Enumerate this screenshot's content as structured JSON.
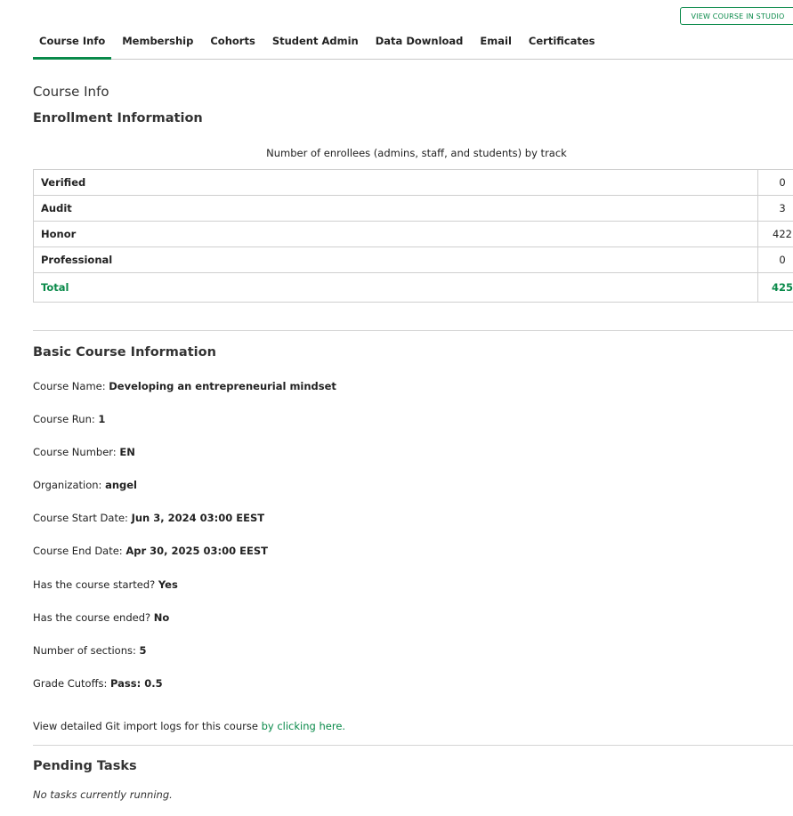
{
  "header": {
    "studio_button": "VIEW COURSE IN STUDIO"
  },
  "tabs": [
    {
      "label": "Course Info",
      "active": true
    },
    {
      "label": "Membership"
    },
    {
      "label": "Cohorts"
    },
    {
      "label": "Student Admin"
    },
    {
      "label": "Data Download"
    },
    {
      "label": "Email"
    },
    {
      "label": "Certificates"
    }
  ],
  "page_title": "Course Info",
  "enrollment": {
    "heading": "Enrollment Information",
    "caption": "Number of enrollees (admins, staff, and students) by track",
    "rows": [
      {
        "label": "Verified",
        "value": "0"
      },
      {
        "label": "Audit",
        "value": "3"
      },
      {
        "label": "Honor",
        "value": "422"
      },
      {
        "label": "Professional",
        "value": "0"
      }
    ],
    "total": {
      "label": "Total",
      "value": "425"
    }
  },
  "basic": {
    "heading": "Basic Course Information",
    "fields": [
      {
        "label": "Course Name: ",
        "value": "Developing an entrepreneurial mindset"
      },
      {
        "label": "Course Run: ",
        "value": "1"
      },
      {
        "label": "Course Number: ",
        "value": "EN"
      },
      {
        "label": "Organization: ",
        "value": "angel"
      },
      {
        "label": "Course Start Date: ",
        "value": "Jun 3, 2024 03:00 EEST"
      },
      {
        "label": "Course End Date: ",
        "value": "Apr 30, 2025 03:00 EEST"
      },
      {
        "label": "Has the course started? ",
        "value": "Yes"
      },
      {
        "label": "Has the course ended? ",
        "value": "No"
      },
      {
        "label": "Number of sections: ",
        "value": "5"
      },
      {
        "label": "Grade Cutoffs: ",
        "value": "Pass: 0.5"
      }
    ],
    "git_text": "View detailed Git import logs for this course ",
    "git_link": "by clicking here."
  },
  "pending": {
    "heading": "Pending Tasks",
    "message": "No tasks currently running."
  },
  "colors": {
    "accent": "#0a8a4a",
    "border": "#cfcfcf"
  }
}
